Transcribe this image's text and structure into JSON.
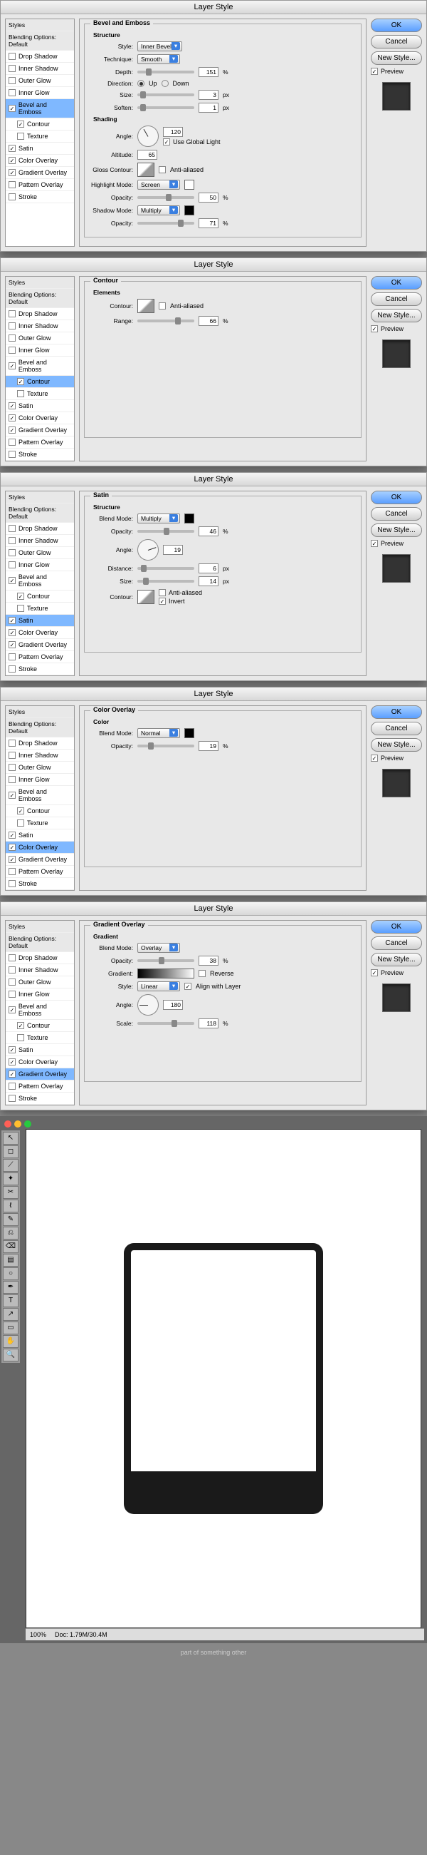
{
  "dialog_title": "Layer Style",
  "sidebar": {
    "blending": "Blending Options: Default",
    "items": [
      "Drop Shadow",
      "Inner Shadow",
      "Outer Glow",
      "Inner Glow",
      "Bevel and Emboss",
      "Contour",
      "Texture",
      "Satin",
      "Color Overlay",
      "Gradient Overlay",
      "Pattern Overlay",
      "Stroke"
    ]
  },
  "buttons": {
    "ok": "OK",
    "cancel": "Cancel",
    "new_style": "New Style...",
    "preview": "Preview"
  },
  "bevel": {
    "title": "Bevel and Emboss",
    "structure": "Structure",
    "style_l": "Style:",
    "style_v": "Inner Bevel",
    "tech_l": "Technique:",
    "tech_v": "Smooth",
    "depth_l": "Depth:",
    "depth_v": "151",
    "pct": "%",
    "dir_l": "Direction:",
    "up": "Up",
    "down": "Down",
    "size_l": "Size:",
    "size_v": "3",
    "px": "px",
    "soften_l": "Soften:",
    "soften_v": "1",
    "shading": "Shading",
    "angle_l": "Angle:",
    "angle_v": "120",
    "global": "Use Global Light",
    "alt_l": "Altitude:",
    "alt_v": "65",
    "gloss_l": "Gloss Contour:",
    "aa": "Anti-aliased",
    "hmode_l": "Highlight Mode:",
    "hmode_v": "Screen",
    "hop_v": "50",
    "smode_l": "Shadow Mode:",
    "smode_v": "Multiply",
    "sop_v": "71",
    "op_l": "Opacity:"
  },
  "contour": {
    "title": "Contour",
    "elements": "Elements",
    "c_l": "Contour:",
    "aa": "Anti-aliased",
    "range_l": "Range:",
    "range_v": "66",
    "pct": "%"
  },
  "satin": {
    "title": "Satin",
    "structure": "Structure",
    "bm_l": "Blend Mode:",
    "bm_v": "Multiply",
    "op_l": "Opacity:",
    "op_v": "46",
    "pct": "%",
    "angle_l": "Angle:",
    "angle_v": "19",
    "dist_l": "Distance:",
    "dist_v": "6",
    "px": "px",
    "size_l": "Size:",
    "size_v": "14",
    "c_l": "Contour:",
    "aa": "Anti-aliased",
    "inv": "Invert"
  },
  "color": {
    "title": "Color Overlay",
    "color_h": "Color",
    "bm_l": "Blend Mode:",
    "bm_v": "Normal",
    "op_l": "Opacity:",
    "op_v": "19",
    "pct": "%"
  },
  "gradient": {
    "title": "Gradient Overlay",
    "h": "Gradient",
    "bm_l": "Blend Mode:",
    "bm_v": "Overlay",
    "op_l": "Opacity:",
    "op_v": "38",
    "pct": "%",
    "grad_l": "Gradient:",
    "rev": "Reverse",
    "style_l": "Style:",
    "style_v": "Linear",
    "align": "Align with Layer",
    "angle_l": "Angle:",
    "angle_v": "180",
    "scale_l": "Scale:",
    "scale_v": "118"
  },
  "status": {
    "zoom": "100%",
    "doc": "Doc: 1.79M/30.4M"
  },
  "footer": "part of something other"
}
